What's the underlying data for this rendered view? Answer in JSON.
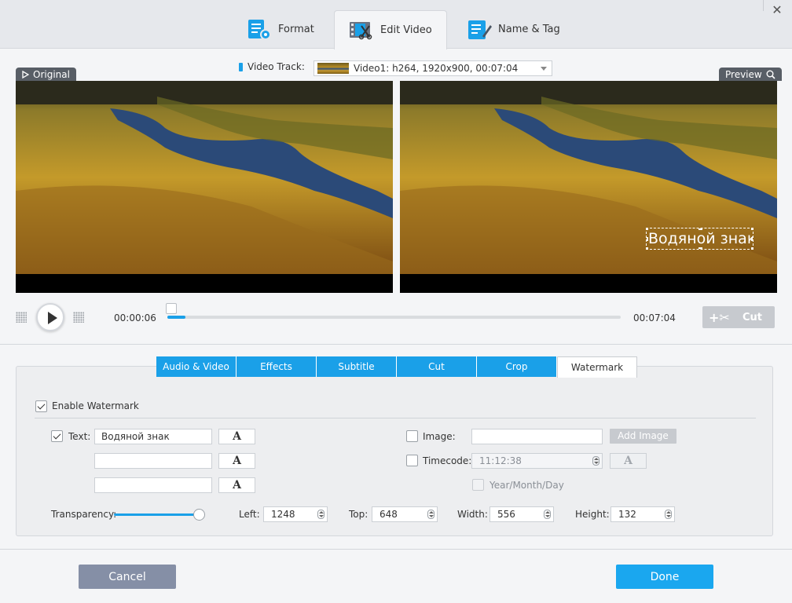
{
  "window": {
    "close_icon": "close-icon"
  },
  "top_tabs": [
    {
      "label": "Format",
      "icon": "format-settings-icon",
      "active": false
    },
    {
      "label": "Edit Video",
      "icon": "edit-video-icon",
      "active": true
    },
    {
      "label": "Name & Tag",
      "icon": "name-tag-icon",
      "active": false
    }
  ],
  "video_track": {
    "label": "Video Track:",
    "selected": "Video1: h264, 1920x900, 00:07:04"
  },
  "panes": {
    "original_label": "Original",
    "preview_label": "Preview"
  },
  "watermark_overlay": "Водяной знак",
  "playback": {
    "current_time": "00:00:06",
    "total_time": "00:07:04",
    "progress": 0.014,
    "cut_label": "Cut"
  },
  "edit_tabs": [
    {
      "label": "Audio & Video",
      "active": false
    },
    {
      "label": "Effects",
      "active": false
    },
    {
      "label": "Subtitle",
      "active": false
    },
    {
      "label": "Cut",
      "active": false
    },
    {
      "label": "Crop",
      "active": false
    },
    {
      "label": "Watermark",
      "active": true
    }
  ],
  "watermark": {
    "enable_label": "Enable Watermark",
    "enabled": true,
    "text_label": "Text:",
    "text_checked": true,
    "text_values": [
      "Водяной знак",
      "",
      ""
    ],
    "font_button_label": "A",
    "image_label": "Image:",
    "image_checked": false,
    "image_value": "",
    "add_image_label": "Add Image",
    "timecode_label": "Timecode:",
    "timecode_checked": false,
    "timecode_value": "11:12:38",
    "ymd_label": "Year/Month/Day",
    "ymd_checked": false,
    "transparency_label": "Transparency:",
    "transparency": 1.0,
    "left_label": "Left:",
    "left_value": "1248",
    "top_label": "Top:",
    "top_value": "648",
    "width_label": "Width:",
    "width_value": "556",
    "height_label": "Height:",
    "height_value": "132"
  },
  "footer": {
    "cancel_label": "Cancel",
    "done_label": "Done"
  },
  "colors": {
    "accent": "#1aa0e8",
    "done": "#1aa7ef",
    "cancel": "#858fa6"
  }
}
